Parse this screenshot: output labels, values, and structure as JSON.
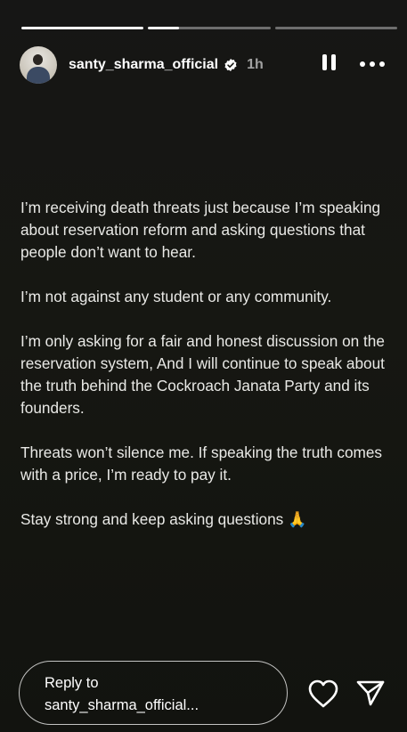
{
  "progress": [
    {
      "fill": 1.0
    },
    {
      "fill": 0.25
    },
    {
      "fill": 0.0
    }
  ],
  "header": {
    "username": "santy_sharma_official",
    "time": "1h",
    "icons": {
      "verified": "verified-badge-icon",
      "pause": "pause-icon",
      "more": "more-options-icon"
    }
  },
  "story": {
    "paragraphs": [
      "I’m receiving death threats just because I’m speaking about reservation reform and asking questions that people don’t want to hear.",
      "I’m not against any student or any community.",
      "I’m only asking for a fair and honest discussion on the reservation system, And I will continue to speak about the truth behind the Cockroach Janata Party and its founders.",
      "Threats won’t silence me. If speaking the truth comes with a price, I’m ready to pay it.",
      "Stay strong and keep asking questions 🙏"
    ]
  },
  "reply": {
    "line1": "Reply to",
    "line2": "santy_sharma_official..."
  },
  "actions": {
    "like_icon": "heart-icon",
    "share_icon": "send-icon"
  },
  "colors": {
    "background": "#161612",
    "text": "#e9e9e6",
    "accent": "#ffffff"
  }
}
